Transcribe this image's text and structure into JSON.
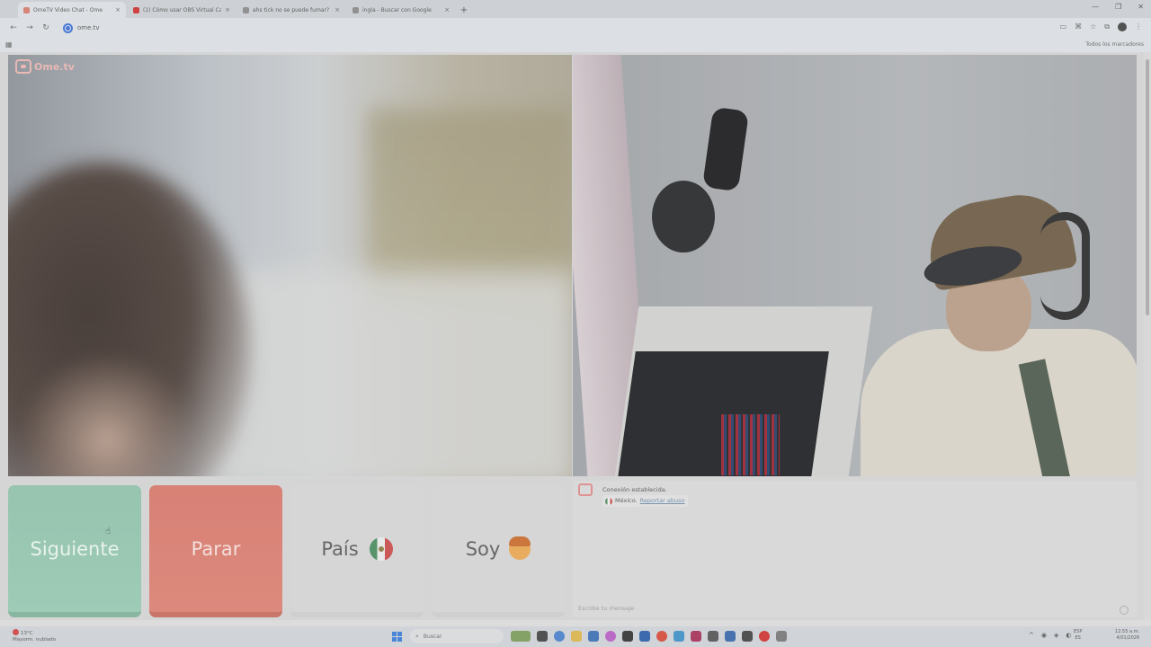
{
  "browser": {
    "tabs": [
      {
        "title": "OmeTV Video Chat - Ome",
        "close": "×",
        "color": "#d27a6a"
      },
      {
        "title": "(1) Cómo usar OBS Virtual Cam",
        "close": "×",
        "color": "#cc3333"
      },
      {
        "title": "ahs tick no se puede fumar?",
        "close": "×",
        "color": "#777777"
      },
      {
        "title": "ingla - Buscar con Google",
        "close": "×",
        "color": "#777777"
      }
    ],
    "new_tab": "+",
    "url": "ome.tv",
    "bookmarks_all": "Todos los marcadores"
  },
  "ome": {
    "logo_text": "Ome.tv",
    "buttons": {
      "next": "Siguiente",
      "stop": "Parar",
      "country": "País",
      "gender": "Soy"
    },
    "chat": {
      "status": "Conexión establecida.",
      "country": "México.",
      "report": "Reportar abuso",
      "input_placeholder": "Escribe tu mensaje"
    }
  },
  "taskbar": {
    "weather_temp": "13°C",
    "weather_desc": "Mayorm. nublado",
    "search_placeholder": "Buscar",
    "lang_line1": "ESP",
    "lang_line2": "ES",
    "time": "12:55 a.m.",
    "date": "4/01/2026"
  },
  "colors": {
    "next": "#8fc0a9",
    "stop": "#d5776b",
    "neutral": "#d3d3d3"
  }
}
